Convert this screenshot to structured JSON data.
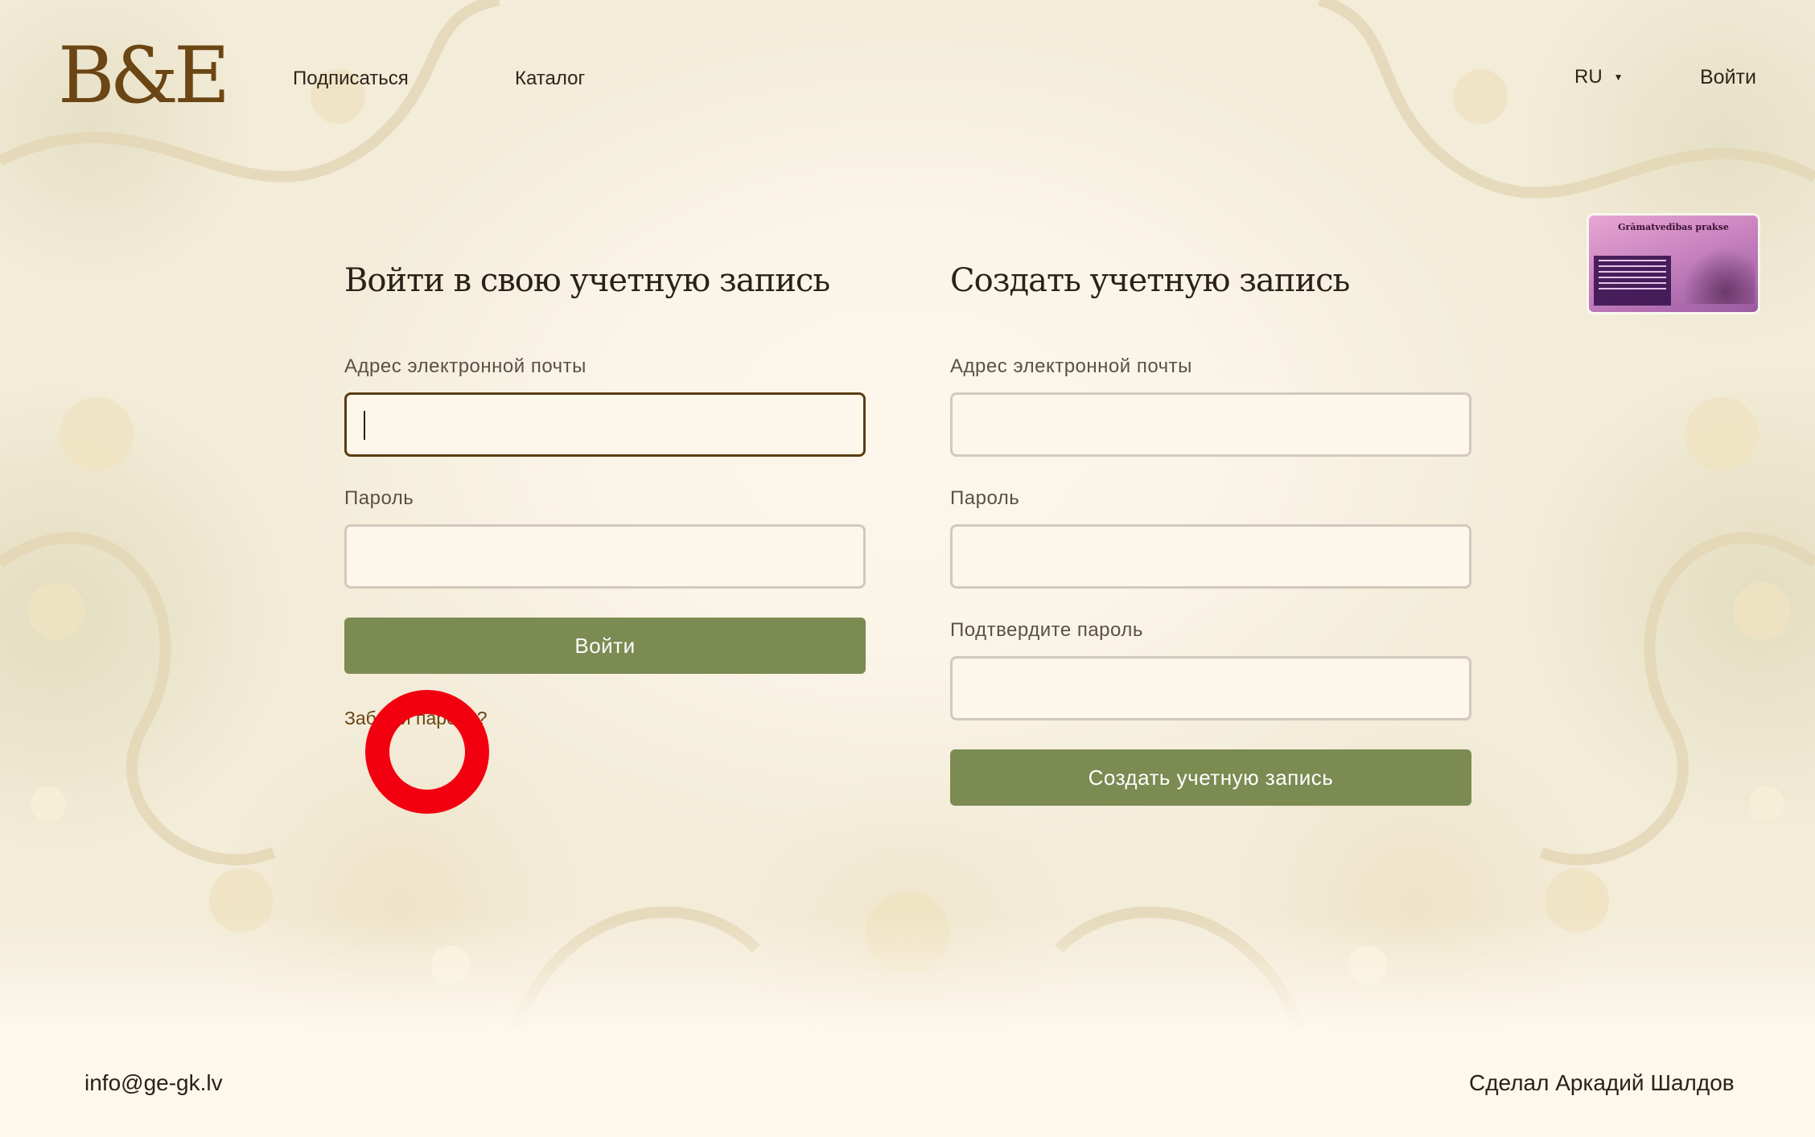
{
  "header": {
    "logo_text": "B&E",
    "nav": {
      "subscribe": "Подписаться",
      "catalog": "Каталог"
    },
    "language": "RU",
    "login": "Войти"
  },
  "thumbnail": {
    "title": "Grāmatvedības prakse"
  },
  "login_form": {
    "title": "Войти в свою учетную запись",
    "email_label": "Адрес электронной почты",
    "email_value": "",
    "password_label": "Пароль",
    "password_value": "",
    "submit_label": "Войти",
    "forgot_link": "Забыли пароль?"
  },
  "register_form": {
    "title": "Создать учетную запись",
    "email_label": "Адрес электронной почты",
    "email_value": "",
    "password_label": "Пароль",
    "password_value": "",
    "confirm_label": "Подтвердите пароль",
    "confirm_value": "",
    "submit_label": "Создать учетную запись"
  },
  "footer": {
    "email": "info@ge-gk.lv",
    "credit": "Сделал Аркадий Шалдов"
  },
  "colors": {
    "accent_button": "#7b8b52",
    "brand": "#6b4513",
    "background": "#fdf7ec",
    "highlight_ring": "#f2000f"
  }
}
